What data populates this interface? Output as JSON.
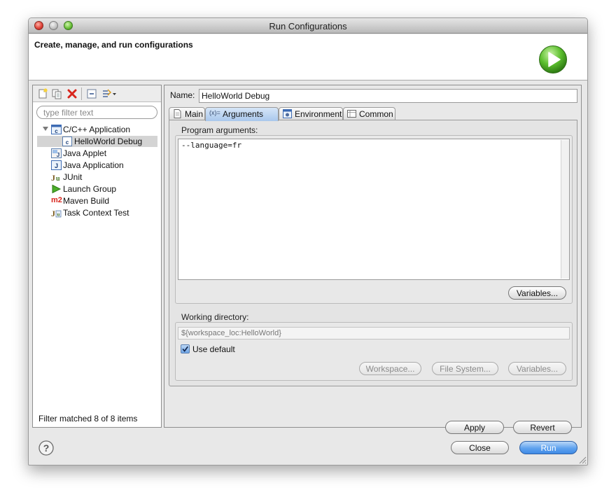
{
  "window": {
    "title": "Run Configurations"
  },
  "banner": {
    "title": "Create, manage, and run configurations"
  },
  "left": {
    "filter_placeholder": "type filter text",
    "tree": [
      {
        "label": "C/C++ Application",
        "icon": "cpp-app-icon",
        "expanded": true
      },
      {
        "label": "HelloWorld Debug",
        "icon": "cpp-config-icon",
        "selected": true
      },
      {
        "label": "Java Applet",
        "icon": "java-applet-icon"
      },
      {
        "label": "Java Application",
        "icon": "java-app-icon"
      },
      {
        "label": "JUnit",
        "icon": "junit-icon"
      },
      {
        "label": "Launch Group",
        "icon": "launch-group-icon"
      },
      {
        "label": "Maven Build",
        "icon": "maven-icon",
        "icon_text": "m2"
      },
      {
        "label": "Task Context Test",
        "icon": "task-context-icon"
      }
    ],
    "status": "Filter matched 8 of 8 items"
  },
  "right": {
    "name_label": "Name:",
    "name_value": "HelloWorld Debug",
    "tabs": [
      {
        "label": "Main",
        "icon": "document-icon"
      },
      {
        "label": "Arguments",
        "icon": "arguments-icon",
        "icon_text": "(x)=",
        "active": true
      },
      {
        "label": "Environment",
        "icon": "environment-icon"
      },
      {
        "label": "Common",
        "icon": "common-icon"
      }
    ],
    "program_args_label": "Program arguments:",
    "program_args_value": "--language=fr",
    "variables_label": "Variables...",
    "workdir_label": "Working directory:",
    "workdir_value": "${workspace_loc:HelloWorld}",
    "use_default_label": "Use default",
    "use_default_checked": true,
    "workspace_btn": "Workspace...",
    "filesystem_btn": "File System...",
    "variables2_btn": "Variables...",
    "apply_btn": "Apply",
    "revert_btn": "Revert"
  },
  "footer": {
    "close_btn": "Close",
    "run_btn": "Run"
  },
  "colors": {
    "accent": "#5fa2ee",
    "run_green": "#4caf2a",
    "selection": "#d4d4d4"
  }
}
